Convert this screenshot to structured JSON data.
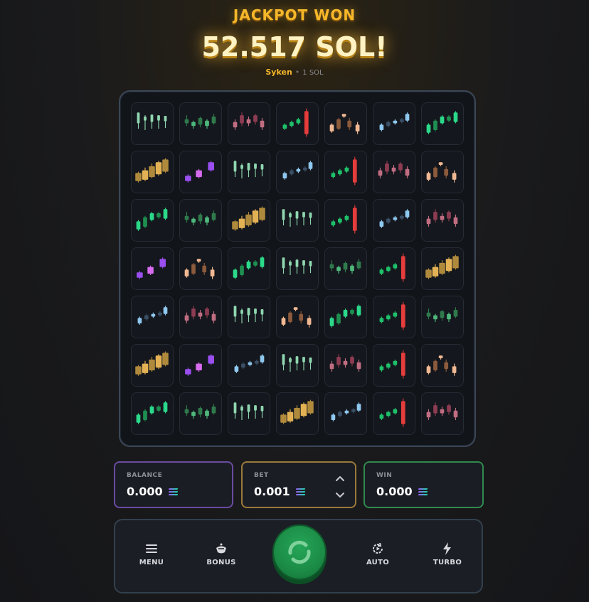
{
  "header": {
    "title": "JACKPOT WON",
    "amount": "52.517 SOL!",
    "winner": "Syken",
    "winner_bet": "1 SOL"
  },
  "board": {
    "rows": 7,
    "cols": 7,
    "symbols": [
      [
        "mint-flat",
        "green-hold",
        "pink-hold",
        "red-spike",
        "peach-zigzag",
        "sky-rise",
        "green-rise"
      ],
      [
        "gold-rise",
        "purple-rise",
        "mint-flat",
        "sky-rise",
        "red-spike",
        "pink-hold",
        "peach-zigzag"
      ],
      [
        "green-rise",
        "green-hold",
        "gold-rise",
        "mint-flat",
        "red-spike",
        "sky-rise",
        "pink-hold"
      ],
      [
        "purple-rise",
        "peach-zigzag",
        "green-rise",
        "mint-flat",
        "green-hold",
        "red-spike",
        "gold-rise"
      ],
      [
        "sky-rise",
        "pink-hold",
        "mint-flat",
        "peach-zigzag",
        "green-rise",
        "red-spike",
        "green-hold"
      ],
      [
        "gold-rise",
        "purple-rise",
        "sky-rise",
        "mint-flat",
        "pink-hold",
        "red-spike",
        "peach-zigzag"
      ],
      [
        "green-rise",
        "green-hold",
        "mint-flat",
        "gold-rise",
        "sky-rise",
        "red-spike",
        "pink-hold"
      ]
    ]
  },
  "balance": {
    "label": "BALANCE",
    "value": "0.000"
  },
  "bet": {
    "label": "BET",
    "value": "0.001"
  },
  "win": {
    "label": "WIN",
    "value": "0.000"
  },
  "controls": {
    "menu": "MENU",
    "bonus": "BONUS",
    "auto": "AUTO",
    "turbo": "TURBO"
  },
  "colors": {
    "title": "#f5b72a",
    "balance_border": "#6a4ba0",
    "bet_border": "#9a7a3a",
    "win_border": "#2f8a4c",
    "spin_button": "#1b8a45"
  }
}
